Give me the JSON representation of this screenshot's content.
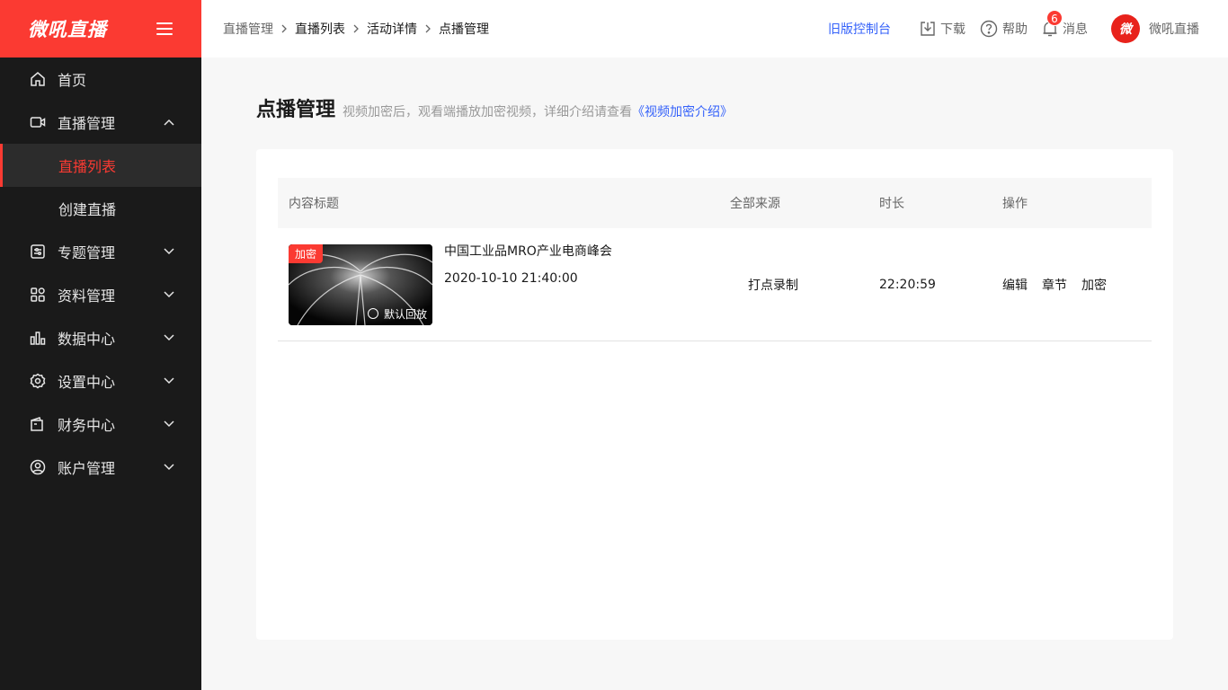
{
  "brand": {
    "logo_text": "微吼直播"
  },
  "sidebar": {
    "items": [
      {
        "label": "首页",
        "icon": "home-icon"
      },
      {
        "label": "直播管理",
        "icon": "video-camera-icon",
        "expanded": true,
        "children": [
          {
            "label": "直播列表",
            "active": true
          },
          {
            "label": "创建直播",
            "active": false
          }
        ]
      },
      {
        "label": "专题管理",
        "icon": "topic-icon"
      },
      {
        "label": "资料管理",
        "icon": "grid-icon"
      },
      {
        "label": "数据中心",
        "icon": "bar-chart-icon"
      },
      {
        "label": "设置中心",
        "icon": "gear-icon"
      },
      {
        "label": "财务中心",
        "icon": "wallet-icon"
      },
      {
        "label": "账户管理",
        "icon": "user-circle-icon"
      }
    ]
  },
  "header": {
    "breadcrumb": [
      "直播管理",
      "直播列表",
      "活动详情",
      "点播管理"
    ],
    "legacy_link": "旧版控制台",
    "download_label": "下载",
    "help_label": "帮助",
    "messages_label": "消息",
    "messages_count": "6",
    "user_name": "微吼直播",
    "avatar_text": "微"
  },
  "page": {
    "title": "点播管理",
    "description": "视频加密后，观看端播放加密视频，详细介绍请查看",
    "description_link": "《视频加密介绍》"
  },
  "table": {
    "columns": [
      "内容标题",
      "全部来源",
      "时长",
      "操作"
    ],
    "rows": [
      {
        "tag": "加密",
        "status": "默认回放",
        "title": "中国工业品MRO产业电商峰会",
        "time": "2020-10-10 21:40:00",
        "source": "打点录制",
        "duration": "22:20:59",
        "actions": [
          "编辑",
          "章节",
          "加密"
        ]
      }
    ]
  },
  "colors": {
    "accent": "#fb3a32",
    "link": "#3562fa",
    "sidebar_bg": "#1a1a1a"
  }
}
